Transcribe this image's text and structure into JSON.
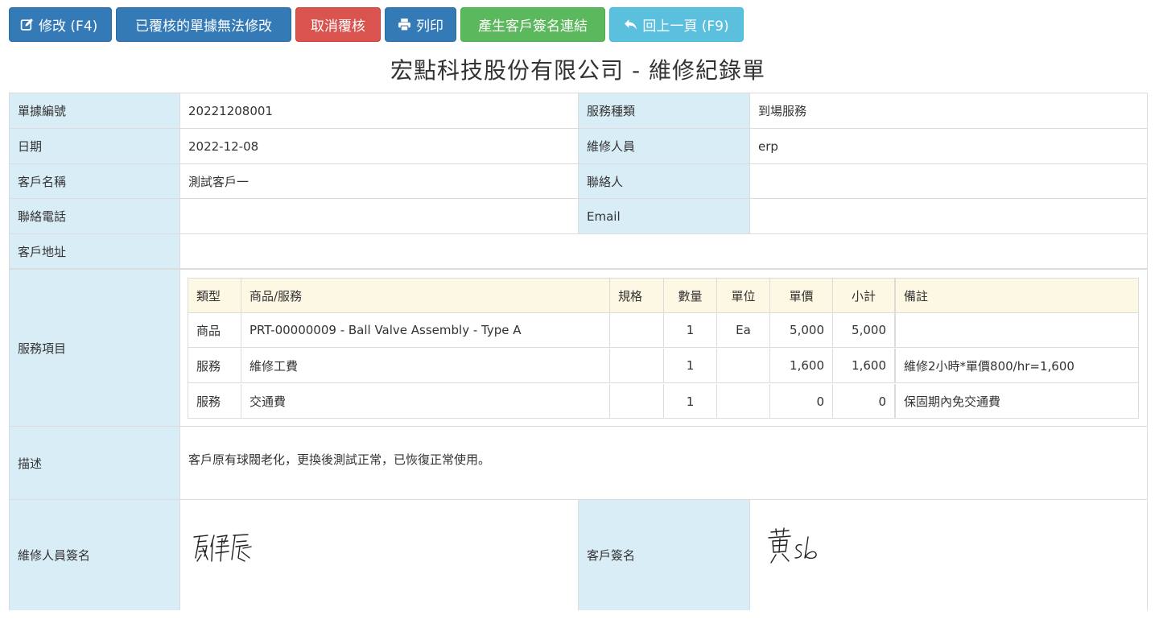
{
  "toolbar": {
    "edit_label": "修改 (F4)",
    "locked_label": "已覆核的單據無法修改",
    "cancel_review_label": "取消覆核",
    "print_label": "列印",
    "sign_link_label": "產生客戶簽名連結",
    "back_label": "回上一頁 (F9)",
    "colors": {
      "primary": "#337ab7",
      "danger": "#d9534f",
      "success": "#5cb85c",
      "info": "#5bc0de"
    },
    "icons": [
      "edit-icon",
      "print-icon",
      "reply-icon"
    ]
  },
  "title": "宏點科技股份有限公司 - 維修紀錄單",
  "form": {
    "doc_no": {
      "label": "單據編號",
      "value": "20221208001"
    },
    "service_type": {
      "label": "服務種類",
      "value": "到場服務"
    },
    "date": {
      "label": "日期",
      "value": "2022-12-08"
    },
    "technician": {
      "label": "維修人員",
      "value": "erp"
    },
    "customer_name": {
      "label": "客戶名稱",
      "value": "測試客戶一"
    },
    "contact": {
      "label": "聯絡人",
      "value": ""
    },
    "phone": {
      "label": "聯絡電話",
      "value": ""
    },
    "email": {
      "label": "Email",
      "value": ""
    },
    "address": {
      "label": "客戶地址",
      "value": ""
    },
    "items_label": "服務項目",
    "description": {
      "label": "描述",
      "value": "客戶原有球閥老化，更換後測試正常，已恢復正常使用。"
    },
    "tech_signature": {
      "label": "維修人員簽名",
      "signature_text": "廖偉辰"
    },
    "customer_signature": {
      "label": "客戶簽名",
      "signature_text": "黃Sb"
    }
  },
  "items": {
    "headers": [
      "類型",
      "商品/服務",
      "規格",
      "數量",
      "單位",
      "單價",
      "小計",
      "備註"
    ],
    "rows": [
      [
        "商品",
        "PRT-00000009 - Ball Valve Assembly - Type A",
        "",
        "1",
        "Ea",
        "5,000",
        "5,000",
        ""
      ],
      [
        "服務",
        "維修工費",
        "",
        "1",
        "",
        "1,600",
        "1,600",
        "維修2小時*單價800/hr=1,600"
      ],
      [
        "服務",
        "交通費",
        "",
        "1",
        "",
        "0",
        "0",
        "保固期內免交通費"
      ]
    ]
  },
  "colors": {
    "label_bg": "#d9edf7",
    "table_head_bg": "#fcf8e3",
    "border": "#dcdcdc"
  }
}
